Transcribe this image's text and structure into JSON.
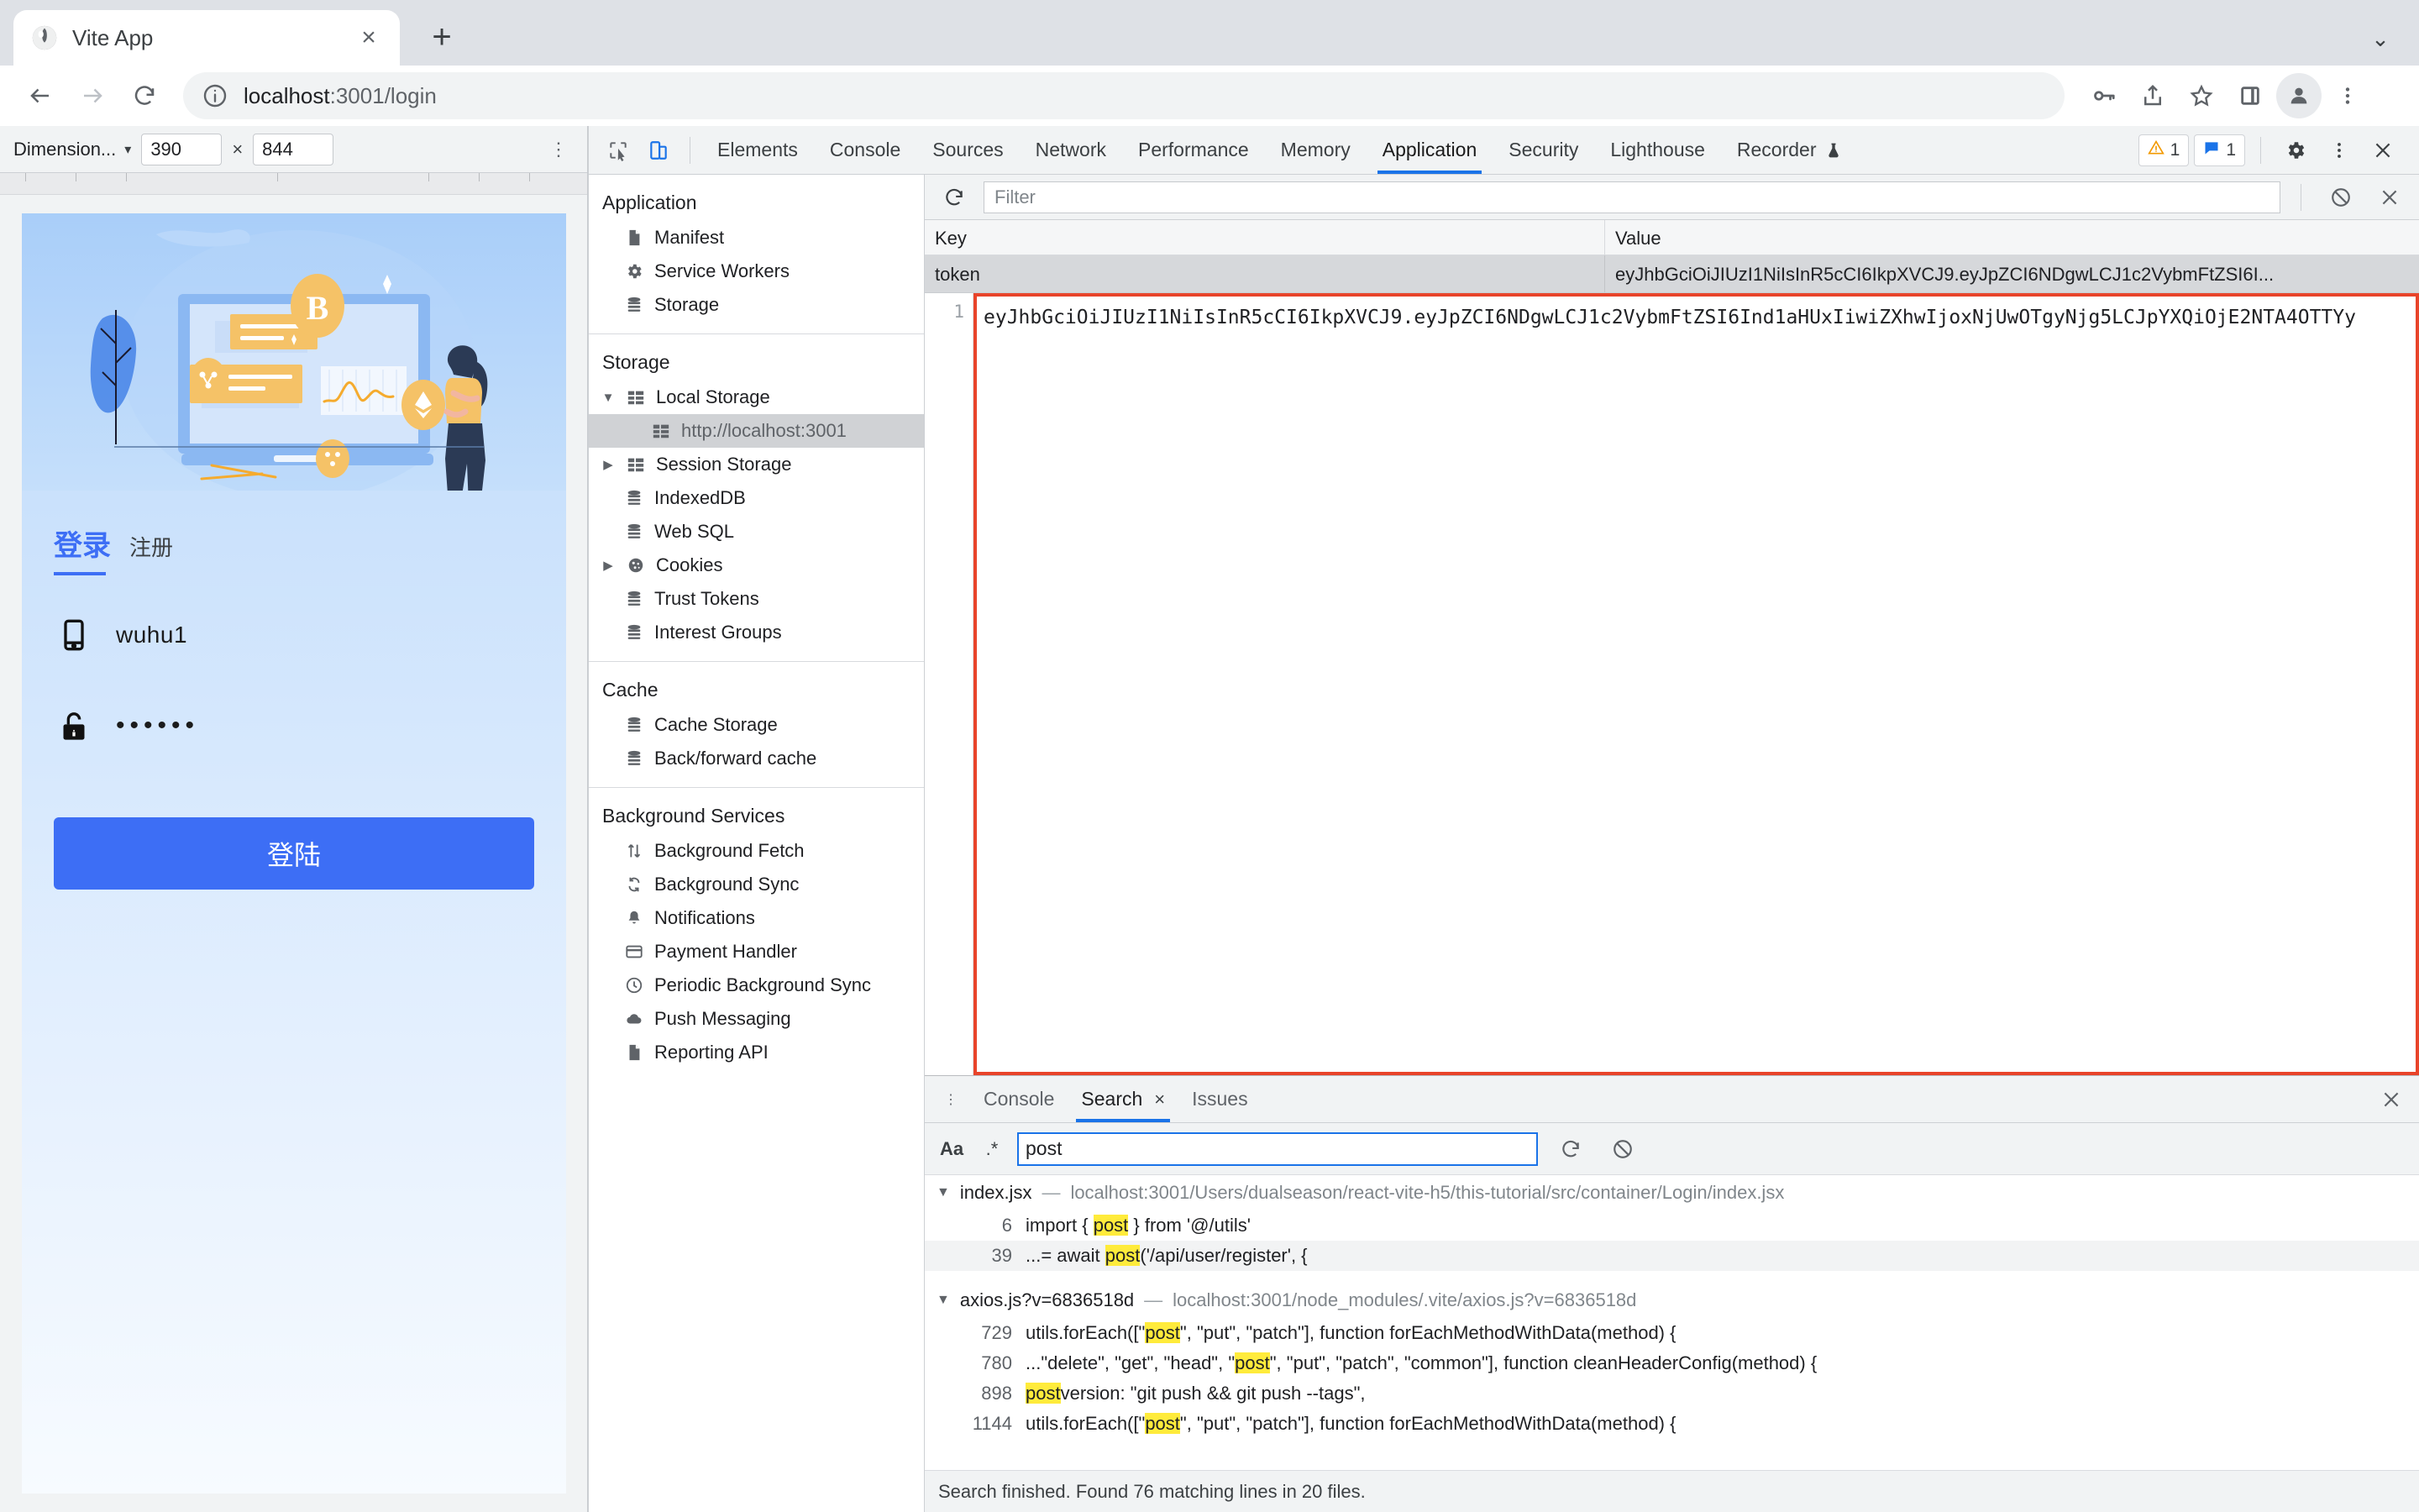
{
  "browser": {
    "tab": {
      "title": "Vite App",
      "favicon": "globe-icon",
      "close": "×"
    },
    "new_tab": "+",
    "tab_list_chevron": "⌄",
    "address": {
      "host": "localhost",
      "path": ":3001/login",
      "full": "localhost:3001/login"
    },
    "nav": {
      "back": "←",
      "forward": "→",
      "reload": "↻"
    },
    "toolbar_icons": [
      "key-icon",
      "share-icon",
      "bookmark-star-icon",
      "side-panel-icon",
      "profile-avatar-icon",
      "chrome-menu-icon"
    ]
  },
  "device_toolbar": {
    "device_label": "Dimension...",
    "caret": "▾",
    "width": "390",
    "times": "×",
    "height": "844",
    "more": "⋮"
  },
  "login_page": {
    "tab_login": "登录",
    "tab_register": "注册",
    "username_value": "wuhu1",
    "username_icon": "phone-icon",
    "password_value": "••••••",
    "password_icon": "lock-icon",
    "submit_label": "登陆",
    "accent_color": "#3d6ef5"
  },
  "devtools": {
    "left_icons": [
      "inspect-element-icon",
      "device-toggle-icon"
    ],
    "tabs": [
      {
        "label": "Elements",
        "selected": false
      },
      {
        "label": "Console",
        "selected": false
      },
      {
        "label": "Sources",
        "selected": false
      },
      {
        "label": "Network",
        "selected": false
      },
      {
        "label": "Performance",
        "selected": false
      },
      {
        "label": "Memory",
        "selected": false
      },
      {
        "label": "Application",
        "selected": true
      },
      {
        "label": "Security",
        "selected": false
      },
      {
        "label": "Lighthouse",
        "selected": false
      },
      {
        "label": "Recorder",
        "selected": false
      }
    ],
    "recorder_suffix_icon": "flask-icon",
    "warnings_count": "1",
    "messages_count": "1",
    "right_icons": [
      "settings-gear-icon",
      "devtools-more-icon",
      "devtools-close-icon"
    ]
  },
  "sidebar": {
    "sections": [
      {
        "title": "Application",
        "items": [
          {
            "label": "Manifest",
            "icon": "manifest-file-icon",
            "indent": 1,
            "arrow": "",
            "selected": false
          },
          {
            "label": "Service Workers",
            "icon": "gear-icon",
            "indent": 1,
            "arrow": "",
            "selected": false
          },
          {
            "label": "Storage",
            "icon": "database-icon",
            "indent": 1,
            "arrow": "",
            "selected": false
          }
        ]
      },
      {
        "title": "Storage",
        "items": [
          {
            "label": "Local Storage",
            "icon": "table-icon",
            "indent": 1,
            "arrow": "▼",
            "selected": false
          },
          {
            "label": "http://localhost:3001",
            "icon": "table-icon",
            "indent": 2,
            "arrow": "",
            "selected": true
          },
          {
            "label": "Session Storage",
            "icon": "table-icon",
            "indent": 1,
            "arrow": "▶",
            "selected": false
          },
          {
            "label": "IndexedDB",
            "icon": "database-icon",
            "indent": 1,
            "arrow": "",
            "selected": false
          },
          {
            "label": "Web SQL",
            "icon": "database-icon",
            "indent": 1,
            "arrow": "",
            "selected": false
          },
          {
            "label": "Cookies",
            "icon": "cookie-icon",
            "indent": 1,
            "arrow": "▶",
            "selected": false
          },
          {
            "label": "Trust Tokens",
            "icon": "database-icon",
            "indent": 1,
            "arrow": "",
            "selected": false
          },
          {
            "label": "Interest Groups",
            "icon": "database-icon",
            "indent": 1,
            "arrow": "",
            "selected": false
          }
        ]
      },
      {
        "title": "Cache",
        "items": [
          {
            "label": "Cache Storage",
            "icon": "database-icon",
            "indent": 1,
            "arrow": "",
            "selected": false
          },
          {
            "label": "Back/forward cache",
            "icon": "database-icon",
            "indent": 1,
            "arrow": "",
            "selected": false
          }
        ]
      },
      {
        "title": "Background Services",
        "items": [
          {
            "label": "Background Fetch",
            "icon": "updown-arrows-icon",
            "indent": 1,
            "arrow": "",
            "selected": false
          },
          {
            "label": "Background Sync",
            "icon": "sync-icon",
            "indent": 1,
            "arrow": "",
            "selected": false
          },
          {
            "label": "Notifications",
            "icon": "bell-icon",
            "indent": 1,
            "arrow": "",
            "selected": false
          },
          {
            "label": "Payment Handler",
            "icon": "credit-card-icon",
            "indent": 1,
            "arrow": "",
            "selected": false
          },
          {
            "label": "Periodic Background Sync",
            "icon": "clock-icon",
            "indent": 1,
            "arrow": "",
            "selected": false
          },
          {
            "label": "Push Messaging",
            "icon": "cloud-icon",
            "indent": 1,
            "arrow": "",
            "selected": false
          },
          {
            "label": "Reporting API",
            "icon": "report-file-icon",
            "indent": 1,
            "arrow": "",
            "selected": false
          }
        ]
      }
    ]
  },
  "storage_panel": {
    "refresh_icon": "refresh-icon",
    "filter_placeholder": "Filter",
    "clear_all_icon": "clear-all-icon",
    "delete_selected_icon": "delete-icon",
    "columns": [
      "Key",
      "Value"
    ],
    "rows": [
      {
        "key": "token",
        "value": "eyJhbGciOiJIUzI1NiIsInR5cCI6IkpXVCJ9.eyJpZCI6NDgwLCJ1c2VybmFtZSI6I..."
      }
    ],
    "preview": {
      "line_number": "1",
      "text": "eyJhbGciOiJIUzI1NiIsInR5cCI6IkpXVCJ9.eyJpZCI6NDgwLCJ1c2VybmFtZSI6Ind1aHUxIiwiZXhwIjoxNjUwOTgyNjg5LCJpYXQiOjE2NTA4OTTYy",
      "highlight_color": "#e8442a"
    }
  },
  "drawer": {
    "more_icon": "⋮",
    "tabs": [
      {
        "label": "Console",
        "selected": false,
        "closable": false
      },
      {
        "label": "Search",
        "selected": true,
        "closable": true
      },
      {
        "label": "Issues",
        "selected": false,
        "closable": false
      }
    ],
    "close_icon": "×",
    "match_case_label": "Aa",
    "regex_label": ".*",
    "query": "post",
    "refresh_icon": "refresh-icon",
    "clear_icon": "clear-icon",
    "results": [
      {
        "file": "index.jsx",
        "dash": "—",
        "url": "localhost:3001/Users/dualseason/react-vite-h5/this-tutorial/src/container/Login/index.jsx",
        "lines": [
          {
            "num": "6",
            "pre": "import { ",
            "match": "post",
            "post": " } from '@/utils'"
          },
          {
            "num": "39",
            "pre": "...= await ",
            "match": "post",
            "post": "('/api/user/register', {"
          }
        ]
      },
      {
        "file": "axios.js?v=6836518d",
        "dash": "—",
        "url": "localhost:3001/node_modules/.vite/axios.js?v=6836518d",
        "lines": [
          {
            "num": "729",
            "pre": "utils.forEach([\"",
            "match": "post",
            "post": "\", \"put\", \"patch\"], function forEachMethodWithData(method) {"
          },
          {
            "num": "780",
            "pre": "...\"delete\", \"get\", \"head\", \"",
            "match": "post",
            "post": "\", \"put\", \"patch\", \"common\"], function cleanHeaderConfig(method) {"
          },
          {
            "num": "898",
            "pre": "",
            "match": "post",
            "post": "version: \"git push && git push --tags\","
          },
          {
            "num": "1144",
            "pre": "utils.forEach([\"",
            "match": "post",
            "post": "\", \"put\", \"patch\"], function forEachMethodWithData(method) {"
          }
        ]
      }
    ],
    "status": "Search finished.  Found 76 matching lines in 20 files."
  }
}
